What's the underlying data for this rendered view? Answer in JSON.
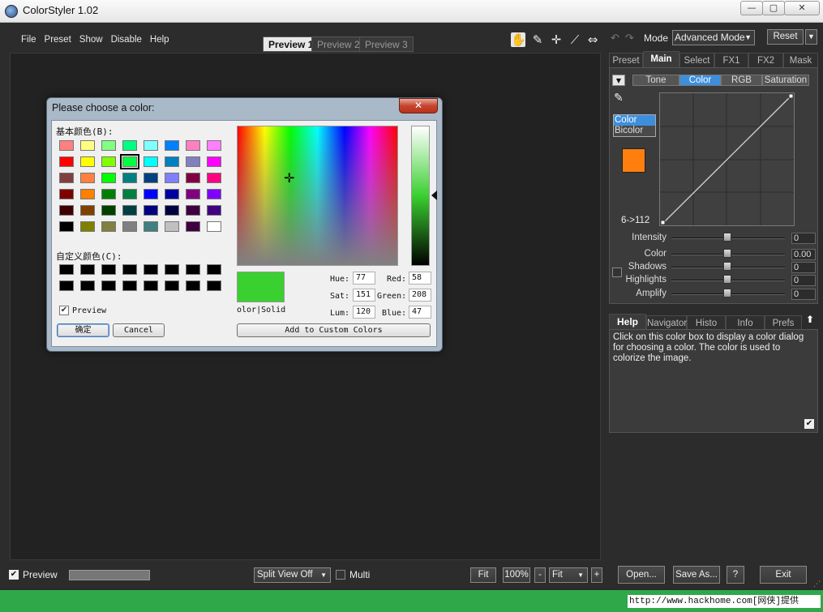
{
  "window": {
    "title": "ColorStyler 1.02",
    "min": "—",
    "max": "▢",
    "close": "✕"
  },
  "menu": [
    "File",
    "Preset",
    "Show",
    "Disable",
    "Help"
  ],
  "preview_tabs": [
    "Preview 1",
    "Preview 2",
    "Preview 3"
  ],
  "mode": {
    "label": "Mode",
    "value": "Advanced Mode",
    "reset": "Reset"
  },
  "right_tabs": [
    "Preset",
    "Main",
    "Select",
    "FX1",
    "FX2",
    "Mask"
  ],
  "sub_tabs": [
    "Tone",
    "Color",
    "RGB",
    "Saturation"
  ],
  "color_modes": [
    "Color",
    "Bicolor"
  ],
  "selected_color": "#ff7f0e",
  "curve_label": "6->112",
  "sliders": [
    {
      "label": "Intensity",
      "value": "0"
    },
    {
      "label": "Color",
      "value": "0.00"
    },
    {
      "label": "Shadows",
      "value": "0"
    },
    {
      "label": "Highlights",
      "value": "0"
    },
    {
      "label": "Amplify",
      "value": "0"
    }
  ],
  "help_tabs": [
    "Help",
    "Navigator",
    "Histo",
    "Info",
    "Prefs"
  ],
  "help_text": "Click on this color box to display a color dialog for choosing a color. The color is used to colorize the image.",
  "bottom": {
    "preview": "Preview",
    "split_view": "Split View Off",
    "multi": "Multi",
    "fit": "Fit",
    "zoom": "100%",
    "minus": "-",
    "fit_select": "Fit",
    "plus": "+",
    "open": "Open...",
    "save_as": "Save As...",
    "help": "?",
    "exit": "Exit"
  },
  "statusbar": "http://www.hackhome.com[网侠]提供",
  "dialog": {
    "title": "Please choose a color:",
    "basic_label": "基本颜色(B):",
    "custom_label": "自定义颜色(C):",
    "basic_colors": [
      "#ff8080",
      "#ffff80",
      "#80ff80",
      "#00ff80",
      "#80ffff",
      "#0080ff",
      "#ff80c0",
      "#ff80ff",
      "#ff0000",
      "#ffff00",
      "#80ff00",
      "#00ff40",
      "#00ffff",
      "#0080c0",
      "#8080c0",
      "#ff00ff",
      "#804040",
      "#ff8040",
      "#00ff00",
      "#008080",
      "#004080",
      "#8080ff",
      "#800040",
      "#ff0080",
      "#800000",
      "#ff8000",
      "#008000",
      "#008040",
      "#0000ff",
      "#0000a0",
      "#800080",
      "#8000ff",
      "#400000",
      "#804000",
      "#004000",
      "#004040",
      "#000080",
      "#000040",
      "#400040",
      "#400080",
      "#000000",
      "#808000",
      "#808040",
      "#808080",
      "#408080",
      "#c0c0c0",
      "#400040",
      "#ffffff"
    ],
    "selected_index": 11,
    "current_color": "#3ad02f",
    "color_solid": "olor|Solid",
    "fields": {
      "hue_label": "Hue:",
      "hue": "77",
      "sat_label": "Sat:",
      "sat": "151",
      "lum_label": "Lum:",
      "lum": "120",
      "red_label": "Red:",
      "red": "58",
      "green_label": "Green:",
      "green": "208",
      "blue_label": "Blue:",
      "blue": "47"
    },
    "preview_label": "Preview",
    "ok": "确定",
    "cancel": "Cancel",
    "add_custom": "Add to Custom Colors"
  }
}
